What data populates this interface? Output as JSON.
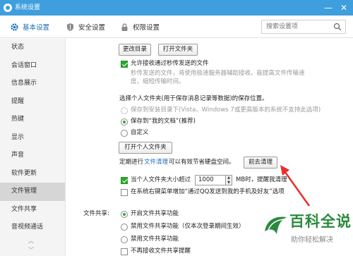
{
  "window": {
    "title": "系统设置",
    "controls": {
      "minimize": "—",
      "close": "✕"
    }
  },
  "tabs": [
    {
      "label": "基本设置",
      "icon": "gear-icon",
      "active": true
    },
    {
      "label": "安全设置",
      "icon": "shield-icon",
      "active": false
    },
    {
      "label": "权限设置",
      "icon": "lock-icon",
      "active": false
    }
  ],
  "search": {
    "placeholder": "搜索设置项"
  },
  "sidebar": {
    "items": [
      {
        "label": "状态"
      },
      {
        "label": "会话窗口"
      },
      {
        "label": "信息展示"
      },
      {
        "label": "提醒"
      },
      {
        "label": "热键"
      },
      {
        "label": "显示"
      },
      {
        "label": "声音"
      },
      {
        "label": "软件更新"
      },
      {
        "label": "文件管理",
        "active": true
      },
      {
        "label": "文件共享"
      },
      {
        "label": "音视频通话"
      }
    ],
    "scroll_up": "︿",
    "scroll_down": "﹀"
  },
  "main": {
    "change_dir_button": "更改目录",
    "open_folder_button": "打开文件夹",
    "allow_transfer_label": "允许接收通过秒传发送的文件",
    "allow_transfer_desc_line1": "秒传发送的文件，将使用极速服务器辅助接收。能提高文件传输速",
    "allow_transfer_desc_line2": "度，缩短传输时间。",
    "personal_folder_heading": "选择个人文件夹(用于保存消息记录等数据)的保存位置。",
    "save_to_install_dir": "保存到安装目录下(Vista、Windows 7或更高版本的系统不支持此选项)",
    "save_to_my_docs": "保存到“我的文档”(推荐)",
    "custom": "自定义",
    "open_personal_folder_button": "打开个人文件夹",
    "cleanup_prefix": "定期进行",
    "cleanup_link": "文件清理",
    "cleanup_suffix": "可以有效节省硬盘空间。",
    "cleanup_button": "前去清理",
    "size_limit_prefix": "当个人文件夹大小超过",
    "size_limit_value": "1000",
    "size_limit_suffix": "MB时，提醒我清理",
    "right_menu_label": "在系统右键菜单增加“通过QQ发送到我的手机及好友”选项",
    "file_share_heading": "文件共享:",
    "share_enable": "开启文件共享功能",
    "share_disable_temp": "禁用文件共享功能（仅本次登录期间生效）",
    "share_disable": "禁用文件共享功能",
    "no_share_reminder": "不再接收文件共享提醒"
  },
  "watermark": {
    "title": "百科全说",
    "subtitle": "助你轻松解决"
  },
  "colors": {
    "titlebar": "#3f9ede",
    "accent": "#1f6fb2",
    "check": "#2ea82e",
    "annotation_arrow": "#e8302a",
    "watermark": "#2a8a3e"
  }
}
